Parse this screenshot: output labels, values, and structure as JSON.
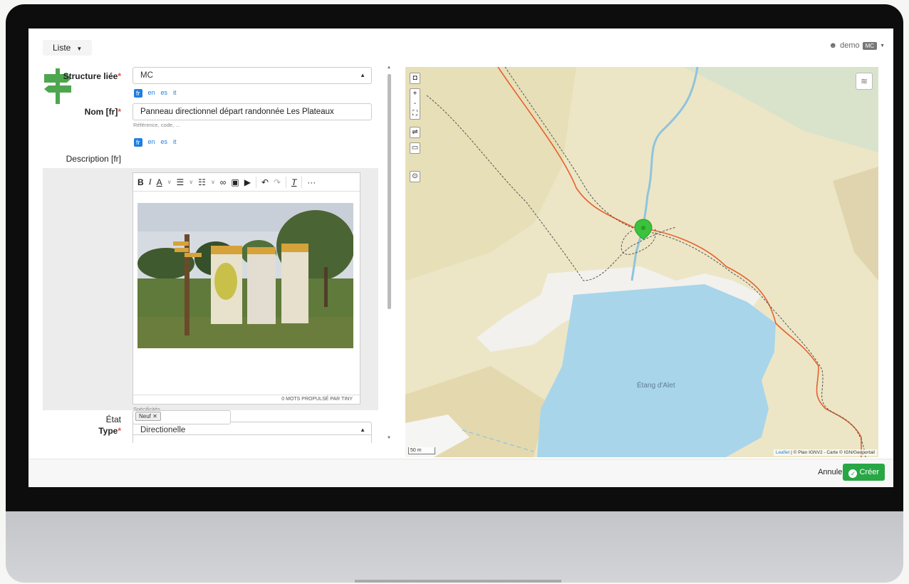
{
  "header": {
    "liste_label": "Liste",
    "user_name": "demo",
    "user_badge": "MC"
  },
  "form": {
    "structure": {
      "label": "Structure liée",
      "value": "MC"
    },
    "langs": {
      "fr": "fr",
      "en": "en",
      "es": "es",
      "it": "it"
    },
    "nom": {
      "label": "Nom [fr]",
      "value": "Panneau directionnel départ randonnée Les Plateaux",
      "help": "Référence, code, ..."
    },
    "description": {
      "label": "Description [fr]",
      "status": "0 MOTS  PROPULSÉ PAR TINY",
      "help": "Spécificités,"
    },
    "type": {
      "label": "Type",
      "value": "Directionelle"
    },
    "etat": {
      "label": "État",
      "tag": "Neuf ✕"
    }
  },
  "map": {
    "lake_label": "Étang d'Alet",
    "scale": "50 m",
    "attribution_link": "Leaflet",
    "attribution_text": " | © Plan IGNV2 - Carte © IGN/Geoportail"
  },
  "footer": {
    "cancel_label": "Annuler",
    "create_label": "Créer"
  },
  "colors": {
    "accent": "#1e7fe0",
    "success": "#28a745",
    "trail": "#e8602c",
    "marker": "#3cc23c"
  }
}
